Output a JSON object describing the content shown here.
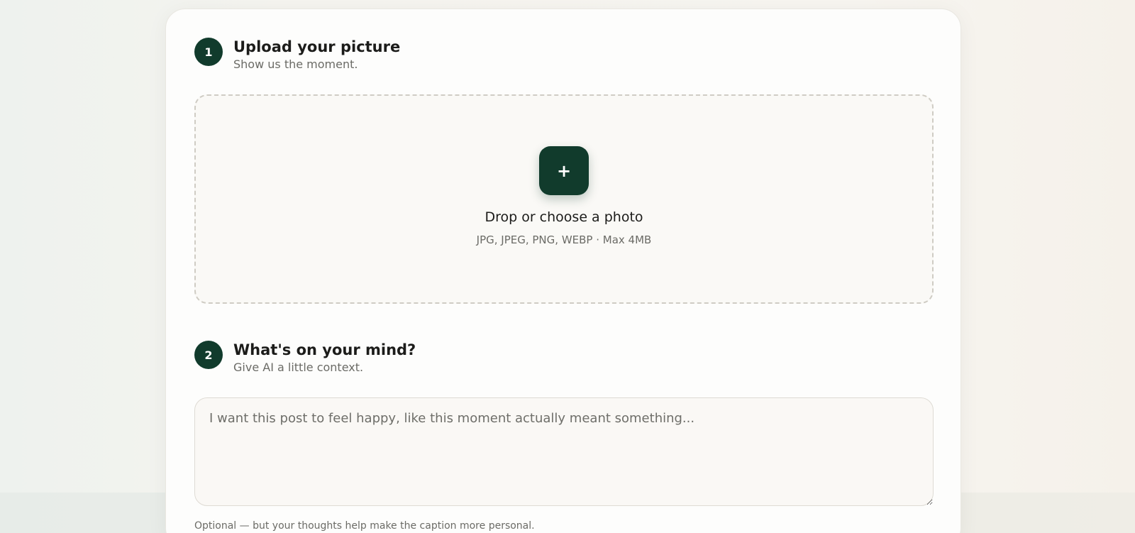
{
  "step1": {
    "number": "1",
    "title": "Upload your picture",
    "subtitle": "Show us the moment."
  },
  "upload": {
    "button_label": "+",
    "title": "Drop or choose a photo",
    "hint": "JPG, JPEG, PNG, WEBP · Max 4MB"
  },
  "step2": {
    "number": "2",
    "title": "What's on your mind?",
    "subtitle": "Give AI a little context."
  },
  "context": {
    "value": "",
    "placeholder": "I want this post to feel happy, like this moment actually meant something...",
    "helper": "Optional — but your thoughts help make the caption more personal."
  },
  "colors": {
    "accent": "#113b2c",
    "background": "#f7f5f0",
    "card": "#fdfdfc"
  }
}
